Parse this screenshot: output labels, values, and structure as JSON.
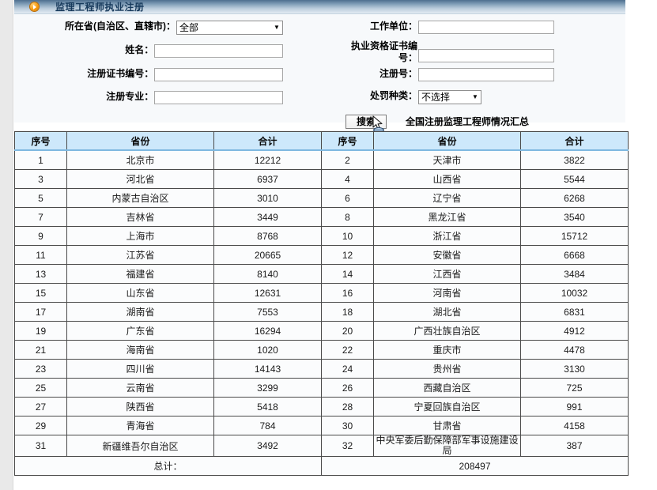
{
  "titlebar": {
    "title": "监理工程师执业注册",
    "bullet_icon": "orange-play-bullet-icon"
  },
  "form": {
    "fields": [
      {
        "label": "所在省(自治区、直辖市)：",
        "type": "select",
        "value": "全部"
      },
      {
        "label": "工作单位：",
        "type": "text",
        "value": "",
        "placeholder": ""
      },
      {
        "label": "姓名：",
        "type": "text",
        "value": "",
        "placeholder": ""
      },
      {
        "label": "执业资格证书编\n号：",
        "type": "text",
        "value": "",
        "placeholder": ""
      },
      {
        "label": "注册证书编号：",
        "type": "text",
        "value": "",
        "placeholder": ""
      },
      {
        "label": "注册号：",
        "type": "text",
        "value": "",
        "placeholder": ""
      },
      {
        "label": "注册专业：",
        "type": "text",
        "value": "",
        "placeholder": ""
      },
      {
        "label": "处罚种类：",
        "type": "select",
        "value": "不选择"
      }
    ],
    "search_button": "搜索",
    "summary_label": "全国注册监理工程师情况汇总",
    "select_caret_icon": "chevron-down-icon",
    "cursor_icon": "mouse-pointer-icon"
  },
  "table": {
    "headers": [
      "序号",
      "省份",
      "合计",
      "序号",
      "省份",
      "合计"
    ],
    "rows": [
      [
        "1",
        "北京市",
        "12212",
        "2",
        "天津市",
        "3822"
      ],
      [
        "3",
        "河北省",
        "6937",
        "4",
        "山西省",
        "5544"
      ],
      [
        "5",
        "内蒙古自治区",
        "3010",
        "6",
        "辽宁省",
        "6268"
      ],
      [
        "7",
        "吉林省",
        "3449",
        "8",
        "黑龙江省",
        "3540"
      ],
      [
        "9",
        "上海市",
        "8768",
        "10",
        "浙江省",
        "15712"
      ],
      [
        "11",
        "江苏省",
        "20665",
        "12",
        "安徽省",
        "6668"
      ],
      [
        "13",
        "福建省",
        "8140",
        "14",
        "江西省",
        "3484"
      ],
      [
        "15",
        "山东省",
        "12631",
        "16",
        "河南省",
        "10032"
      ],
      [
        "17",
        "湖南省",
        "7553",
        "18",
        "湖北省",
        "6831"
      ],
      [
        "19",
        "广东省",
        "16294",
        "20",
        "广西壮族自治区",
        "4912"
      ],
      [
        "21",
        "海南省",
        "1020",
        "22",
        "重庆市",
        "4478"
      ],
      [
        "23",
        "四川省",
        "14143",
        "24",
        "贵州省",
        "3130"
      ],
      [
        "25",
        "云南省",
        "3299",
        "26",
        "西藏自治区",
        "725"
      ],
      [
        "27",
        "陕西省",
        "5418",
        "28",
        "宁夏回族自治区",
        "991"
      ],
      [
        "29",
        "青海省",
        "784",
        "30",
        "甘肃省",
        "4158"
      ],
      [
        "31",
        "新疆维吾尔自治区",
        "3492",
        "32",
        "中央军委后勤保障部军事设施建设局",
        "387"
      ]
    ],
    "total_label": "总计：",
    "total_value": "208497"
  },
  "colors": {
    "header_bg": "#cde8fb",
    "header_rule": "#7fb8e0",
    "titlebar_dark": "#4d6e8e",
    "accent_orange": "#f79a0d",
    "grid_line": "#4a4a4a"
  }
}
